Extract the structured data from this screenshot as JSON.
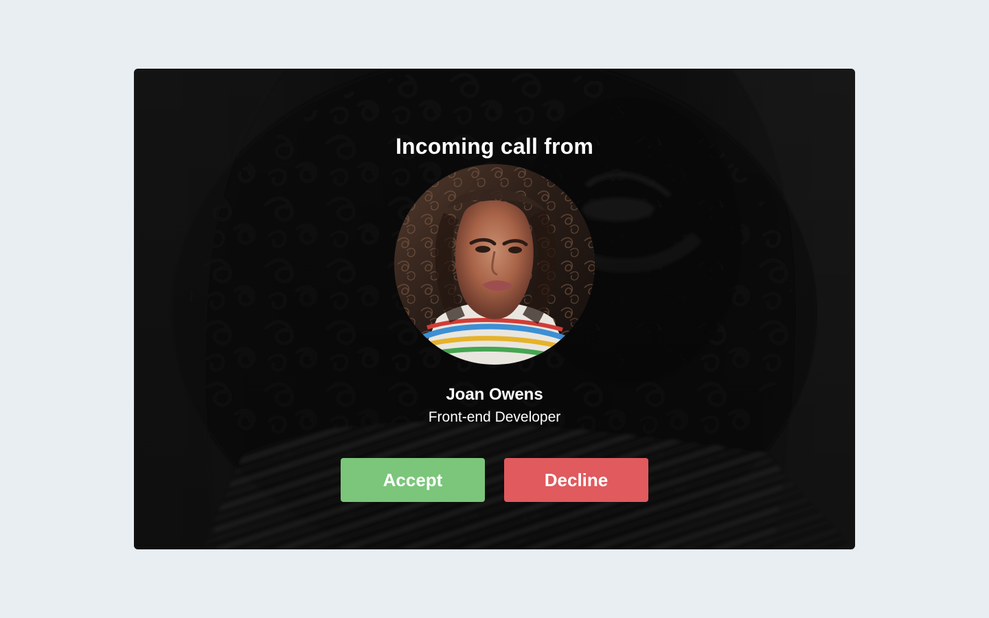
{
  "call": {
    "title": "Incoming call from",
    "caller": {
      "name": "Joan Owens",
      "role": "Front-end Developer"
    },
    "actions": {
      "accept_label": "Accept",
      "decline_label": "Decline"
    }
  },
  "colors": {
    "page_background": "#e9eef2",
    "accept": "#7bc67a",
    "decline": "#e05a5e",
    "text": "#ffffff"
  },
  "icons": {
    "avatar": "caller-photo"
  }
}
